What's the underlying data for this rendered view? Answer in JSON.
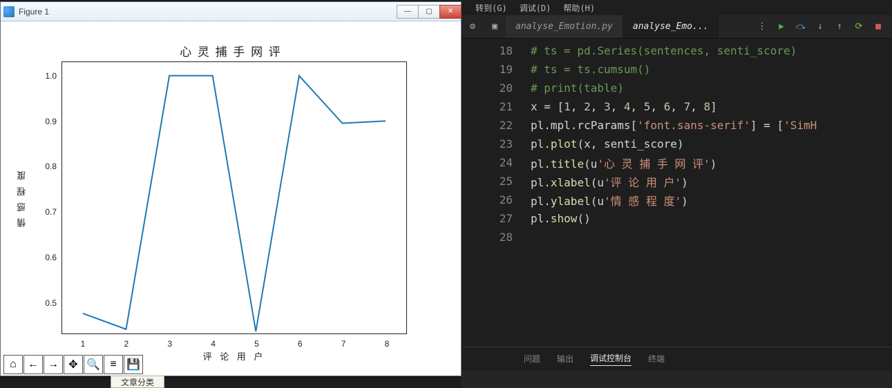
{
  "figure": {
    "window_title": "Figure 1",
    "winbtn_min": "—",
    "winbtn_max": "▢",
    "winbtn_close": "✕"
  },
  "chart_data": {
    "type": "line",
    "title": "心 灵 捕 手 网 评",
    "xlabel": "评 论 用 户",
    "ylabel": "情 感 程 度",
    "x": [
      1,
      2,
      3,
      4,
      5,
      6,
      7,
      8
    ],
    "values": [
      0.475,
      0.44,
      1.0,
      1.0,
      0.435,
      1.0,
      0.895,
      0.9
    ],
    "yticks": [
      0.5,
      0.6,
      0.7,
      0.8,
      0.9,
      1.0
    ],
    "ylim": [
      0.43,
      1.03
    ]
  },
  "mpl_toolbar": {
    "home": "⌂",
    "back": "←",
    "forward": "→",
    "pan": "✥",
    "zoom": "🔍",
    "configure": "≡",
    "save": "💾"
  },
  "menu": {
    "goto": "转到(G)",
    "debug": "调试(D)",
    "help": "帮助(H)"
  },
  "tabs": {
    "tab1": "analyse_Emotion.py",
    "tab2": "analyse_Emo..."
  },
  "code_lines": [
    {
      "n": "18",
      "tokens": [
        {
          "cls": "c-comment",
          "t": "# ts = pd.Series(sentences, senti_score)"
        }
      ]
    },
    {
      "n": "19",
      "tokens": [
        {
          "cls": "c-comment",
          "t": "# ts = ts.cumsum()"
        }
      ]
    },
    {
      "n": "20",
      "tokens": [
        {
          "cls": "c-comment",
          "t": "# print(table)"
        }
      ]
    },
    {
      "n": "21",
      "tokens": [
        {
          "cls": "c-ident",
          "t": "x "
        },
        {
          "cls": "c-op",
          "t": "= "
        },
        {
          "cls": "c-punc",
          "t": "["
        },
        {
          "cls": "c-num",
          "t": "1"
        },
        {
          "cls": "c-punc",
          "t": ", "
        },
        {
          "cls": "c-num",
          "t": "2"
        },
        {
          "cls": "c-punc",
          "t": ", "
        },
        {
          "cls": "c-num",
          "t": "3"
        },
        {
          "cls": "c-punc",
          "t": ", "
        },
        {
          "cls": "c-num",
          "t": "4"
        },
        {
          "cls": "c-punc",
          "t": ", "
        },
        {
          "cls": "c-num",
          "t": "5"
        },
        {
          "cls": "c-punc",
          "t": ", "
        },
        {
          "cls": "c-num",
          "t": "6"
        },
        {
          "cls": "c-punc",
          "t": ", "
        },
        {
          "cls": "c-num",
          "t": "7"
        },
        {
          "cls": "c-punc",
          "t": ", "
        },
        {
          "cls": "c-num",
          "t": "8"
        },
        {
          "cls": "c-punc",
          "t": "]"
        }
      ]
    },
    {
      "n": "22",
      "tokens": [
        {
          "cls": "c-ident",
          "t": "pl.mpl.rcParams"
        },
        {
          "cls": "c-punc",
          "t": "["
        },
        {
          "cls": "c-str",
          "t": "'font.sans-serif'"
        },
        {
          "cls": "c-punc",
          "t": "] "
        },
        {
          "cls": "c-op",
          "t": "= "
        },
        {
          "cls": "c-punc",
          "t": "["
        },
        {
          "cls": "c-str",
          "t": "'SimH"
        }
      ]
    },
    {
      "n": "23",
      "tokens": [
        {
          "cls": "c-ident",
          "t": "pl."
        },
        {
          "cls": "c-call",
          "t": "plot"
        },
        {
          "cls": "c-punc",
          "t": "("
        },
        {
          "cls": "c-ident",
          "t": "x, senti_score"
        },
        {
          "cls": "c-punc",
          "t": ")"
        }
      ]
    },
    {
      "n": "24",
      "tokens": [
        {
          "cls": "c-ident",
          "t": "pl."
        },
        {
          "cls": "c-call",
          "t": "title"
        },
        {
          "cls": "c-punc",
          "t": "("
        },
        {
          "cls": "c-ident",
          "t": "u"
        },
        {
          "cls": "c-str",
          "t": "'心 灵 捕 手 网 评'"
        },
        {
          "cls": "c-punc",
          "t": ")"
        }
      ]
    },
    {
      "n": "25",
      "tokens": [
        {
          "cls": "c-ident",
          "t": "pl."
        },
        {
          "cls": "c-call",
          "t": "xlabel"
        },
        {
          "cls": "c-punc",
          "t": "("
        },
        {
          "cls": "c-ident",
          "t": "u"
        },
        {
          "cls": "c-str",
          "t": "'评 论 用 户'"
        },
        {
          "cls": "c-punc",
          "t": ")"
        }
      ]
    },
    {
      "n": "26",
      "tokens": [
        {
          "cls": "c-ident",
          "t": "pl."
        },
        {
          "cls": "c-call",
          "t": "ylabel"
        },
        {
          "cls": "c-punc",
          "t": "("
        },
        {
          "cls": "c-ident",
          "t": "u"
        },
        {
          "cls": "c-str",
          "t": "'情 感 程 度'"
        },
        {
          "cls": "c-punc",
          "t": ")"
        }
      ]
    },
    {
      "n": "27",
      "tokens": [
        {
          "cls": "c-ident",
          "t": "pl."
        },
        {
          "cls": "c-call",
          "t": "show"
        },
        {
          "cls": "c-punc",
          "t": "()"
        }
      ]
    },
    {
      "n": "28",
      "tokens": []
    }
  ],
  "bottom_panel": {
    "problems": "问题",
    "output": "输出",
    "debug_console": "调试控制台",
    "terminal": "终端"
  },
  "behind_tab_label": "文章分类"
}
